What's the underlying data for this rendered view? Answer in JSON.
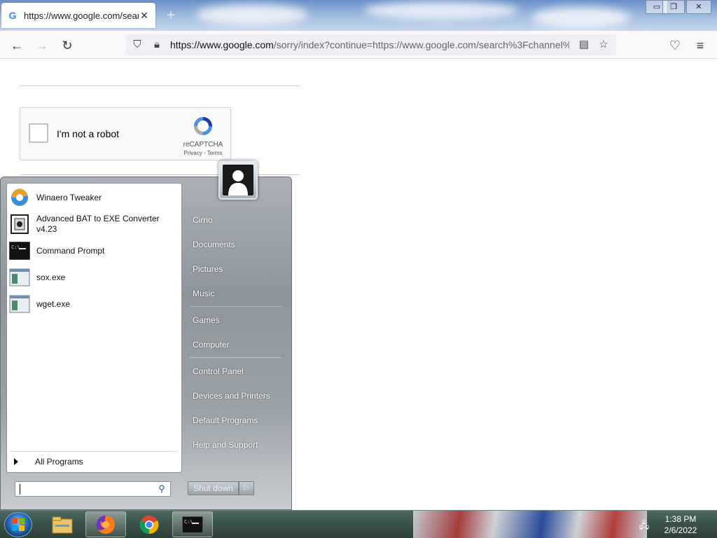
{
  "browser": {
    "tab_title": "https://www.google.com/search",
    "tab_favicon": "G",
    "tab_close": "✕",
    "new_tab": "+",
    "window_controls": {
      "minimize": "▭",
      "restore": "❐",
      "close": "✕"
    },
    "url_host": "https://www.google.com",
    "url_rest": "/sorry/index?continue=https://www.google.com/search%3Fchannel%",
    "icons": [
      "back-icon",
      "forward-icon",
      "reload-icon",
      "shield-icon",
      "lock-icon",
      "reader-icon",
      "star-icon",
      "pocket-icon",
      "menu-icon"
    ]
  },
  "captcha": {
    "label": "I'm not a robot",
    "brand": "reCAPTCHA",
    "links": "Privacy - Terms"
  },
  "start_menu": {
    "programs": [
      {
        "label": "Winaero Tweaker",
        "icon": "winaero-icon"
      },
      {
        "label": "Advanced BAT to EXE Converter v4.23",
        "icon": "bat-converter-icon"
      },
      {
        "label": "Command Prompt",
        "icon": "cmd-icon"
      },
      {
        "label": "sox.exe",
        "icon": "exe-icon"
      },
      {
        "label": "wget.exe",
        "icon": "exe-icon"
      }
    ],
    "all_programs": "All Programs",
    "search_value": "",
    "right_items": [
      "Cirrio",
      "Documents",
      "Pictures",
      "Music",
      "Games",
      "Computer",
      "Control Panel",
      "Devices and Printers",
      "Default Programs",
      "Help and Support"
    ],
    "shutdown": "Shut down",
    "shutdown_arrow": "▷"
  },
  "taskbar": {
    "items": [
      "explorer-icon",
      "firefox-icon",
      "chrome-icon",
      "cmd-icon"
    ],
    "time": "1:38 PM",
    "date": "2/6/2022"
  },
  "colors": {
    "accent": "#4285f4",
    "startmenu": "#9aa1a7",
    "taskbar": "#3a5249"
  }
}
